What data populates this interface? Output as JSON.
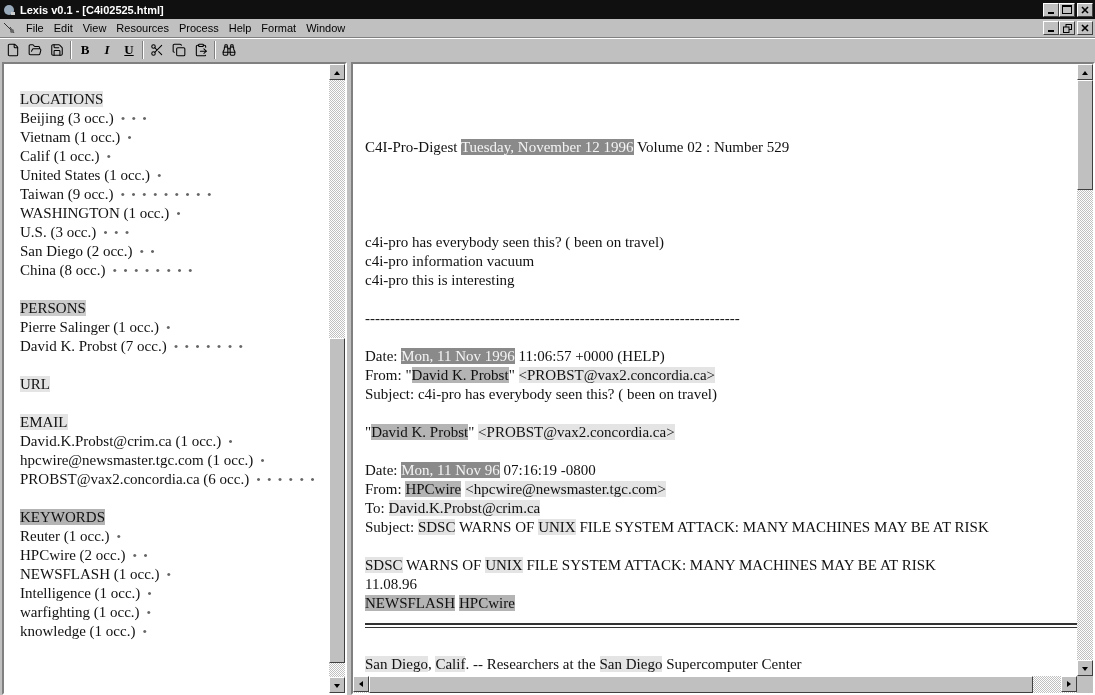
{
  "window": {
    "title": "Lexis v0.1 - [C4i02525.html]"
  },
  "menu": [
    "File",
    "Edit",
    "View",
    "Resources",
    "Process",
    "Help",
    "Format",
    "Window"
  ],
  "toolbar": [
    {
      "kind": "new"
    },
    {
      "kind": "open"
    },
    {
      "kind": "save"
    },
    {
      "kind": "sep"
    },
    {
      "kind": "bold",
      "label": "B"
    },
    {
      "kind": "italic",
      "label": "I"
    },
    {
      "kind": "underline",
      "label": "U"
    },
    {
      "kind": "sep"
    },
    {
      "kind": "cut"
    },
    {
      "kind": "copy"
    },
    {
      "kind": "paste"
    },
    {
      "kind": "sep"
    },
    {
      "kind": "find"
    }
  ],
  "sidebar": {
    "sections": [
      {
        "heading": "LOCATIONS",
        "color": "#e4e4e4",
        "items": [
          {
            "label": "Beijing (3 occ.)",
            "marks": "• • •"
          },
          {
            "label": "Vietnam (1 occ.)",
            "marks": "•"
          },
          {
            "label": "Calif (1 occ.)",
            "marks": "•"
          },
          {
            "label": "United States (1 occ.)",
            "marks": "•"
          },
          {
            "label": "Taiwan (9 occ.)",
            "marks": "• • • • • • • • •"
          },
          {
            "label": "WASHINGTON (1 occ.)",
            "marks": "•"
          },
          {
            "label": "U.S. (3 occ.)",
            "marks": "• • •"
          },
          {
            "label": "San Diego (2 occ.)",
            "marks": "• •"
          },
          {
            "label": "China (8 occ.)",
            "marks": "• • • • • • • •"
          }
        ]
      },
      {
        "heading": "PERSONS",
        "color": "#cccccc",
        "items": [
          {
            "label": "Pierre Salinger (1 occ.)",
            "marks": "•"
          },
          {
            "label": "David K. Probst (7 occ.)",
            "marks": "• • • • • • •"
          }
        ]
      },
      {
        "heading": "URL",
        "color": "#e4e4e4"
      },
      {
        "heading": "EMAIL",
        "color": "#e4e4e4",
        "items": [
          {
            "label": "David.K.Probst@crim.ca (1 occ.)",
            "marks": "•"
          },
          {
            "label": "hpcwire@newsmaster.tgc.com (1 occ.)",
            "marks": "•"
          },
          {
            "label": "PROBST@vax2.concordia.ca (6 occ.)",
            "marks": "• • • • • •"
          }
        ]
      },
      {
        "heading": "KEYWORDS",
        "color": "#b4b4b4",
        "items": [
          {
            "label": "Reuter (1 occ.)",
            "marks": "•"
          },
          {
            "label": "HPCwire (2 occ.)",
            "marks": "• •"
          },
          {
            "label": "NEWSFLASH (1 occ.)",
            "marks": "•"
          },
          {
            "label": "Intelligence (1 occ.)",
            "marks": "•"
          },
          {
            "label": "warfighting (1 occ.)",
            "marks": "•"
          },
          {
            "label": "knowledge (1 occ.)",
            "marks": "•"
          }
        ]
      }
    ]
  },
  "document": {
    "blocks": [
      {
        "kind": "header",
        "lines": [
          [
            {
              "text": "C4I-Pro-Digest "
            },
            {
              "text": "Tuesday, November 12 1996",
              "color": "#8a8a8a"
            },
            {
              "text": " Volume 02 : Number 529"
            }
          ]
        ]
      },
      {
        "kind": "para",
        "lines": [
          [
            {
              "text": "c4i-pro has everybody seen this? ( been on travel)"
            }
          ],
          [
            {
              "text": "c4i-pro information vacuum"
            }
          ],
          [
            {
              "text": "c4i-pro this is interesting"
            }
          ]
        ]
      },
      {
        "kind": "para",
        "lines": [
          [
            {
              "text": "---------------------------------------------------------------------------"
            }
          ]
        ]
      },
      {
        "kind": "para",
        "lines": [
          [
            {
              "text": "Date: "
            },
            {
              "text": "Mon, 11 Nov 1996",
              "color": "#8a8a8a"
            },
            {
              "text": " 11:06:57 +0000 (HELP)"
            }
          ],
          [
            {
              "text": "From: \""
            },
            {
              "text": "David K. Probst",
              "color": "#b4b4b4"
            },
            {
              "text": "\" "
            },
            {
              "text": "<PROBST@vax2.concordia.ca>",
              "color": "#e4e4e4"
            }
          ],
          [
            {
              "text": "Subject: c4i-pro has everybody seen this? ( been on travel)"
            }
          ]
        ]
      },
      {
        "kind": "para",
        "lines": [
          [
            {
              "text": "\""
            },
            {
              "text": "David K. Probst",
              "color": "#b4b4b4"
            },
            {
              "text": "\" "
            },
            {
              "text": "<PROBST@vax2.concordia.ca>",
              "color": "#e4e4e4"
            }
          ]
        ]
      },
      {
        "kind": "para",
        "lines": [
          [
            {
              "text": "Date: "
            },
            {
              "text": "Mon, 11 Nov 96",
              "color": "#8a8a8a"
            },
            {
              "text": " 07:16:19 -0800"
            }
          ],
          [
            {
              "text": "From: "
            },
            {
              "text": "HPCwire",
              "color": "#b4b4b4"
            },
            {
              "text": "<hpcwire@newsmaster.tgc.com>",
              "color": "#e4e4e4"
            }
          ],
          [
            {
              "text": "To: "
            },
            {
              "text": "David.K.Probst@crim.ca",
              "color": "#e4e4e4"
            }
          ],
          [
            {
              "text": "Subject: "
            },
            {
              "text": "SDSC",
              "color": "#e4e4e4"
            },
            {
              "text": " WARNS OF "
            },
            {
              "text": "UNIX",
              "color": "#e4e4e4"
            },
            {
              "text": " FILE SYSTEM ATTACK: MANY MACHINES MAY BE AT RISK"
            }
          ]
        ]
      },
      {
        "kind": "para",
        "lines": [
          [
            {
              "text": "SDSC",
              "color": "#e4e4e4"
            },
            {
              "text": " WARNS OF "
            },
            {
              "text": "UNIX",
              "color": "#e4e4e4"
            },
            {
              "text": " FILE SYSTEM ATTACK: MANY MACHINES MAY BE AT RISK"
            }
          ],
          [
            {
              "text": "11.08.96"
            }
          ],
          [
            {
              "text": "NEWSFLASH",
              "color": "#b4b4b4"
            },
            {
              "text": "HPCwire",
              "color": "#b4b4b4"
            }
          ]
        ]
      },
      {
        "kind": "rule"
      },
      {
        "kind": "para",
        "lines": [
          [
            {
              "text": "San Diego",
              "color": "#e4e4e4"
            },
            {
              "text": ", "
            },
            {
              "text": "Calif",
              "color": "#e4e4e4"
            },
            {
              "text": ". -- Researchers at the "
            },
            {
              "text": "San Diego",
              "color": "#e4e4e4"
            },
            {
              "text": " Supercomputer Center"
            }
          ]
        ]
      }
    ]
  }
}
